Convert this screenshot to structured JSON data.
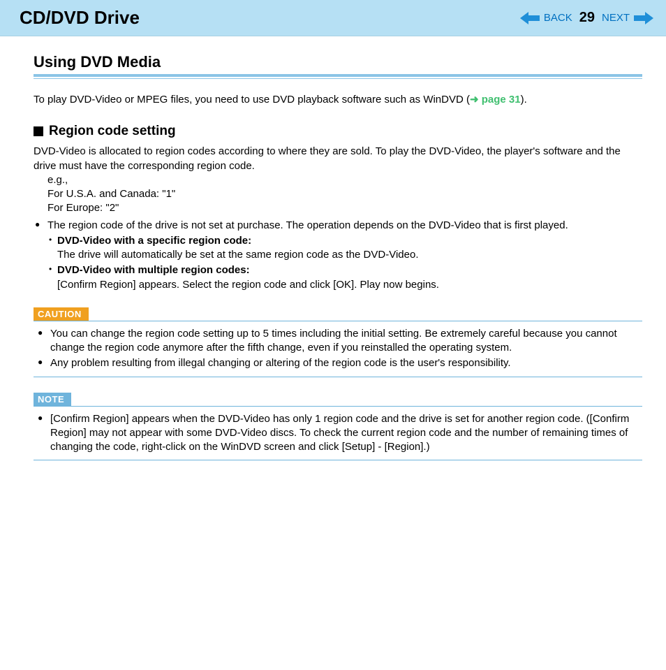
{
  "header": {
    "title": "CD/DVD Drive",
    "back": "BACK",
    "next": "NEXT",
    "page_num": "29"
  },
  "section": {
    "title": "Using DVD Media",
    "intro_a": "To play DVD-Video or MPEG files, you need to use DVD playback software such as WinDVD (",
    "intro_link": "page 31",
    "intro_b": ").",
    "sub_title": "Region code setting",
    "p1": "DVD-Video is allocated to region codes according to where they are sold. To play the DVD-Video, the player's software and the drive must have the corresponding region code.",
    "eg": "e.g.,",
    "eg_usa": "For U.S.A. and Canada: \"1\"",
    "eg_eu": "For Europe: \"2\"",
    "bullet1": "The region code of the drive is not set at purchase. The operation depends on the DVD-Video that is first played.",
    "sb1_title": "DVD-Video with a specific region code:",
    "sb1_text": "The drive will automatically be set at the same region code as the DVD-Video.",
    "sb2_title": "DVD-Video with multiple region codes:",
    "sb2_text": "[Confirm Region] appears. Select the region code and click [OK]. Play now begins.",
    "caution_label": "CAUTION",
    "caution1": "You can change the region code setting up to 5 times including the initial setting. Be extremely careful because you cannot change the region code anymore after the fifth change, even if you reinstalled the operating system.",
    "caution2": "Any problem resulting from illegal changing or altering of the region code is the user's responsibility.",
    "note_label": "NOTE",
    "note1": "[Confirm Region] appears when the DVD-Video has only 1 region code and the drive is set for another region code. ([Confirm Region] may not appear with some DVD-Video discs. To check the current region code and the number of remaining times of changing the code, right-click on the WinDVD screen and click [Setup] - [Region].)"
  }
}
